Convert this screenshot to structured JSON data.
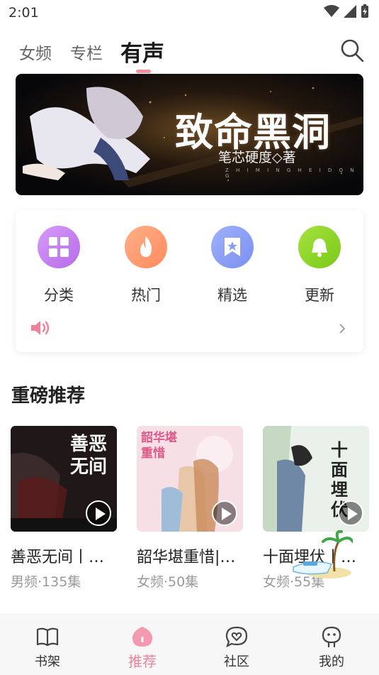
{
  "status": {
    "time": "2:01"
  },
  "tabs": [
    {
      "label": "女频",
      "active": false
    },
    {
      "label": "专栏",
      "active": false
    },
    {
      "label": "有声",
      "active": true
    }
  ],
  "banner": {
    "title": "致命黑洞",
    "author": "笔芯硬度◇著",
    "subtitle": "Z H I M I N G H E I D O N G"
  },
  "quick": {
    "items": [
      {
        "label": "分类",
        "icon": "grid-icon",
        "color": "#c77cf0"
      },
      {
        "label": "热门",
        "icon": "flame-icon",
        "color": "#ff9b6b"
      },
      {
        "label": "精选",
        "icon": "bookmark-star-icon",
        "color": "#8a9cf5"
      },
      {
        "label": "更新",
        "icon": "bell-icon",
        "color": "#8bd324"
      }
    ]
  },
  "section": {
    "title": "重磅推荐"
  },
  "books": [
    {
      "title": "善恶无间丨…",
      "meta": "男频·135集",
      "cover_text": "善恶无间"
    },
    {
      "title": "韶华堪重惜|…",
      "meta": "女频·50集",
      "cover_text": "韶华堪重惜"
    },
    {
      "title": "十面埋伏丨…",
      "meta": "女频·55集",
      "cover_text": "十面埋伏"
    }
  ],
  "bottom_nav": [
    {
      "label": "书架",
      "active": false
    },
    {
      "label": "推荐",
      "active": true
    },
    {
      "label": "社区",
      "active": false
    },
    {
      "label": "我的",
      "active": false
    }
  ],
  "colors": {
    "accent": "#f0819a",
    "banner_bg": "#0b0b0f"
  }
}
